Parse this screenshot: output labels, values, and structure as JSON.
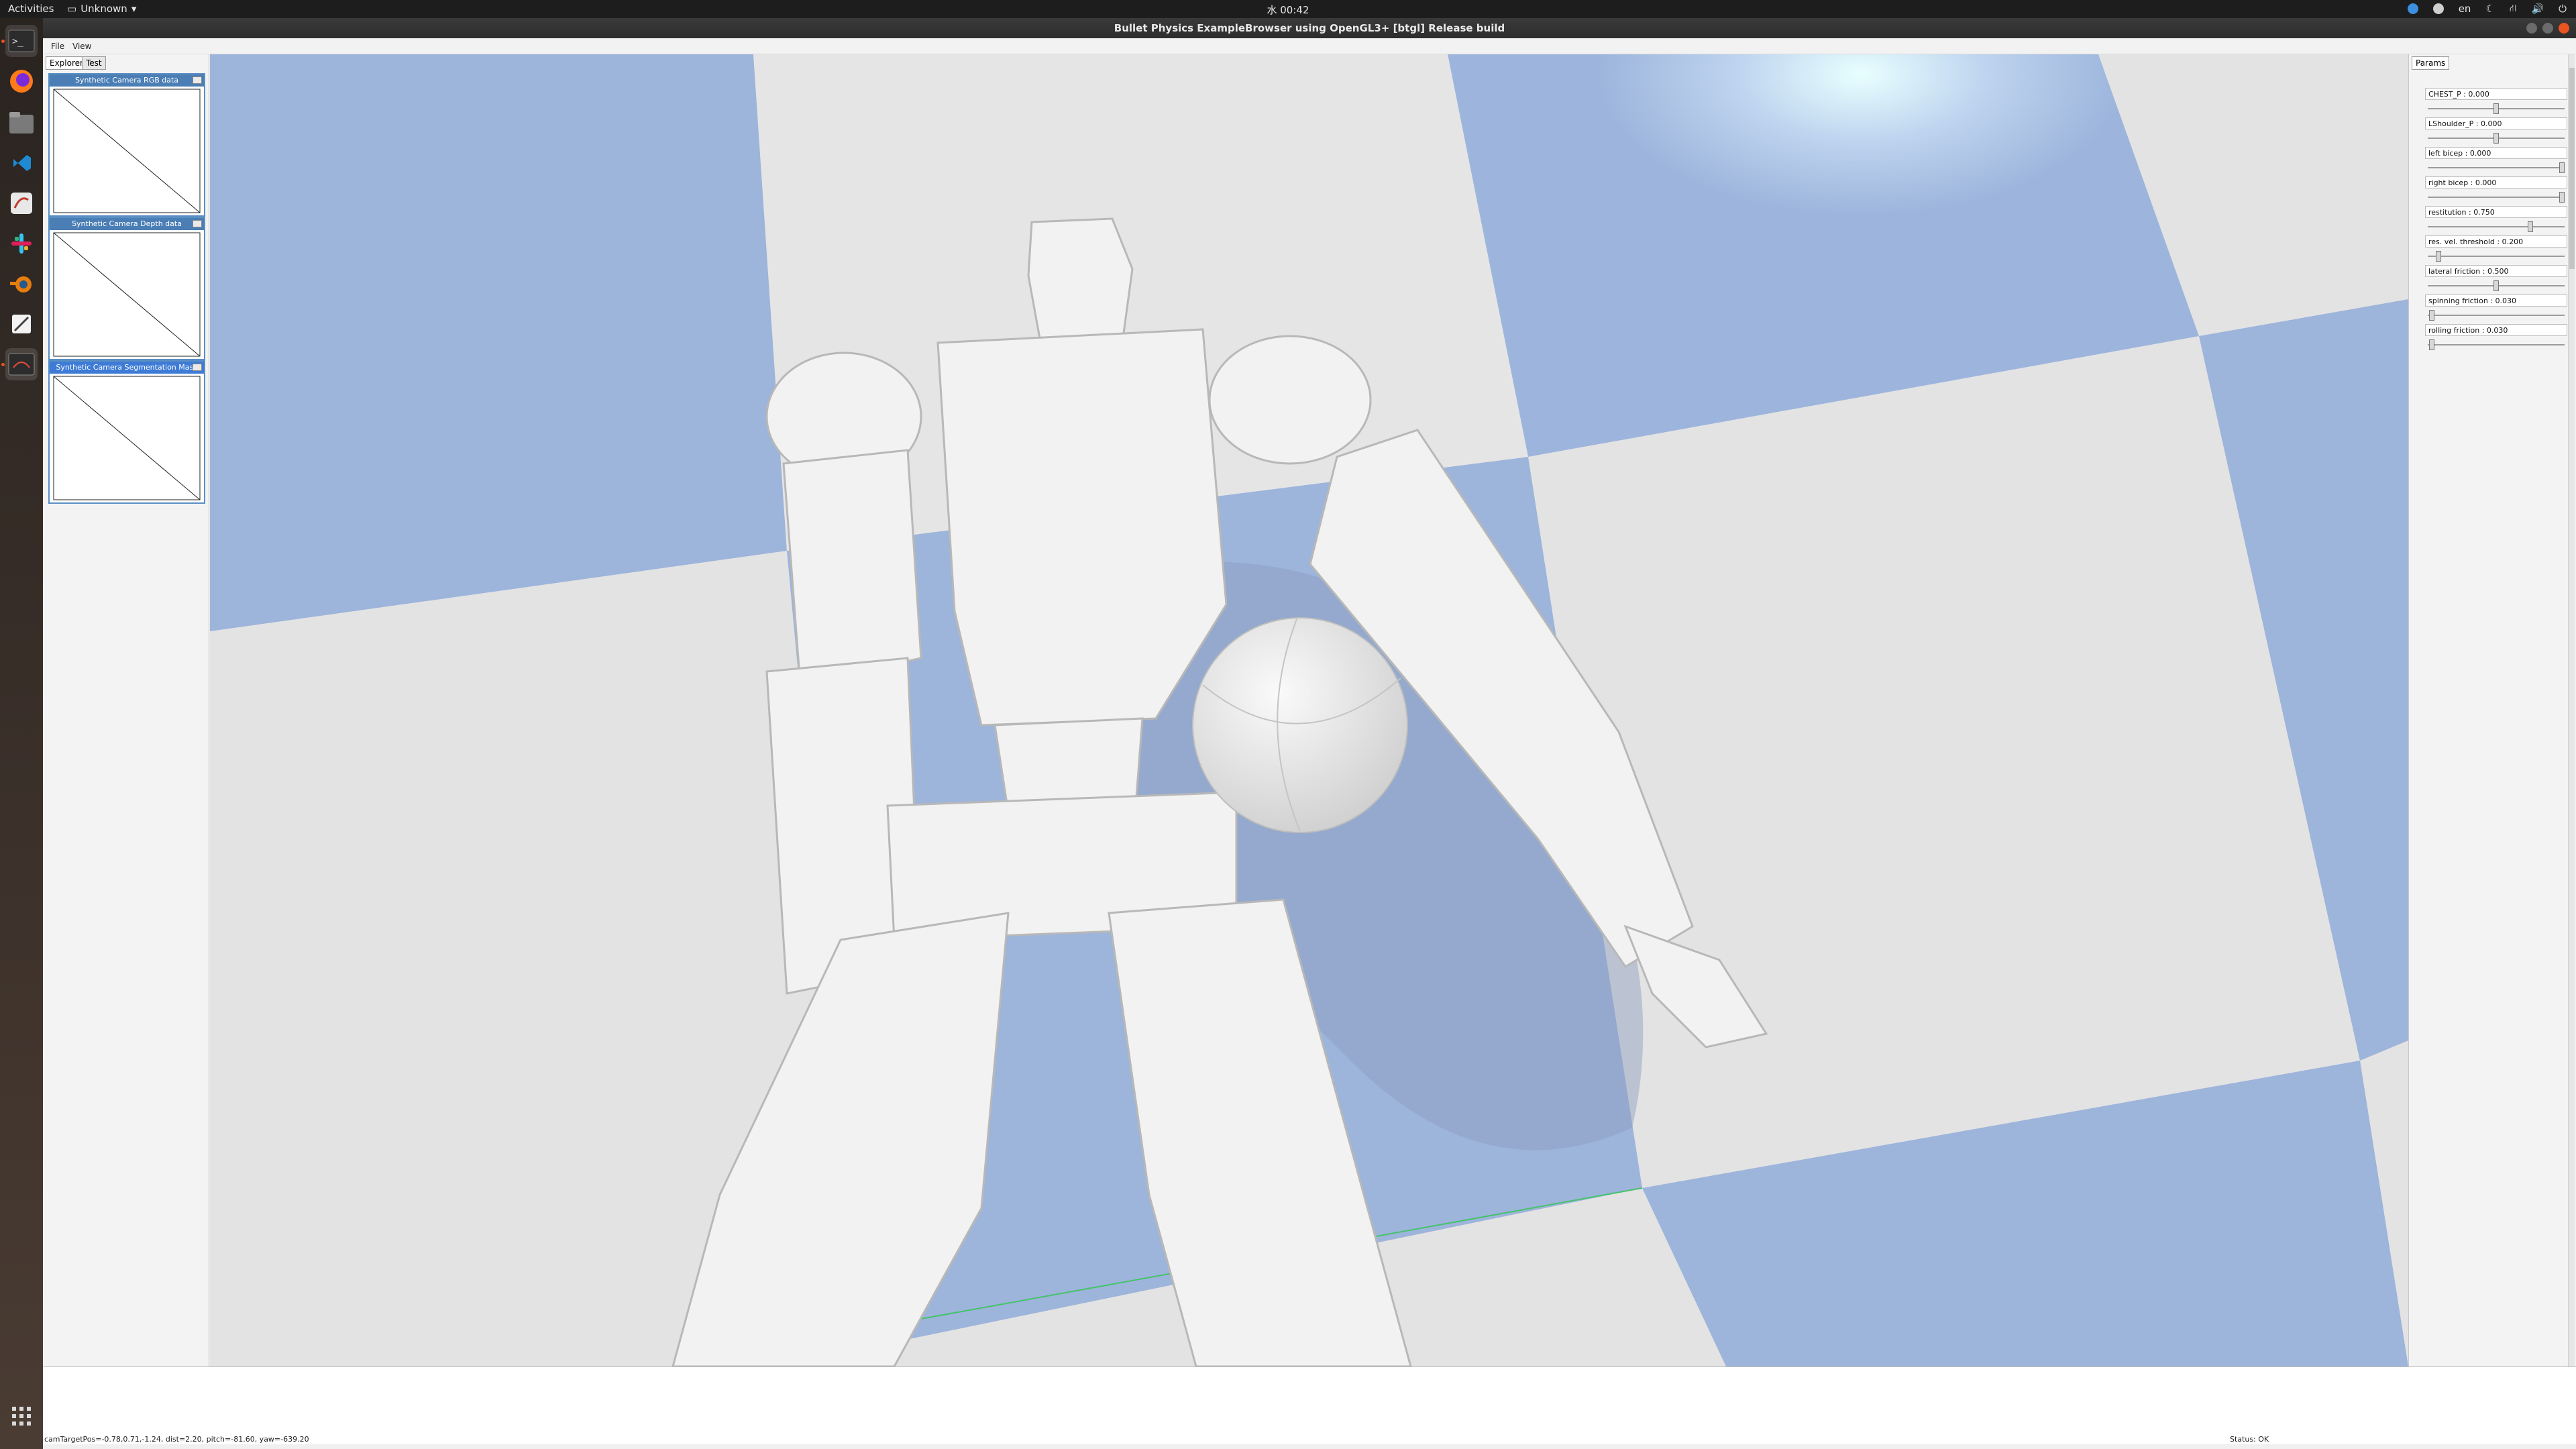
{
  "topbar": {
    "activities": "Activities",
    "app_menu": "Unknown",
    "clock": "水 00:42",
    "language": "en"
  },
  "dock": {
    "items": [
      "terminal-icon",
      "firefox-icon",
      "files-icon",
      "vscode-icon",
      "text-editor-icon",
      "slack-icon",
      "blender-icon",
      "notes-icon",
      "bullet-app-icon"
    ]
  },
  "window": {
    "title": "Bullet Physics ExampleBrowser using OpenGL3+ [btgl] Release build"
  },
  "menu": {
    "file": "File",
    "view": "View"
  },
  "explorer": {
    "tabs": [
      "Explorer",
      "Test"
    ],
    "panels": [
      {
        "title": "Synthetic Camera RGB data"
      },
      {
        "title": "Synthetic Camera Depth data"
      },
      {
        "title": "Synthetic Camera Segmentation Mask"
      }
    ]
  },
  "params": {
    "tab": "Params",
    "sliders": [
      {
        "label": "CHEST_P : 0.000",
        "position": 0.5
      },
      {
        "label": "LShoulder_P : 0.000",
        "position": 0.5
      },
      {
        "label": "left bicep : 0.000",
        "position": 0.98
      },
      {
        "label": "right bicep : 0.000",
        "position": 0.98
      },
      {
        "label": "restitution : 0.750",
        "position": 0.75
      },
      {
        "label": "res. vel. threshold : 0.200",
        "position": 0.08
      },
      {
        "label": "lateral friction : 0.500",
        "position": 0.5
      },
      {
        "label": "spinning friction : 0.030",
        "position": 0.03
      },
      {
        "label": "rolling friction : 0.030",
        "position": 0.03
      }
    ]
  },
  "status": {
    "camera": "camTargetPos=-0.78,0.71,-1.24, dist=2.20, pitch=-81.60, yaw=-639.20",
    "state": "Status: OK"
  }
}
